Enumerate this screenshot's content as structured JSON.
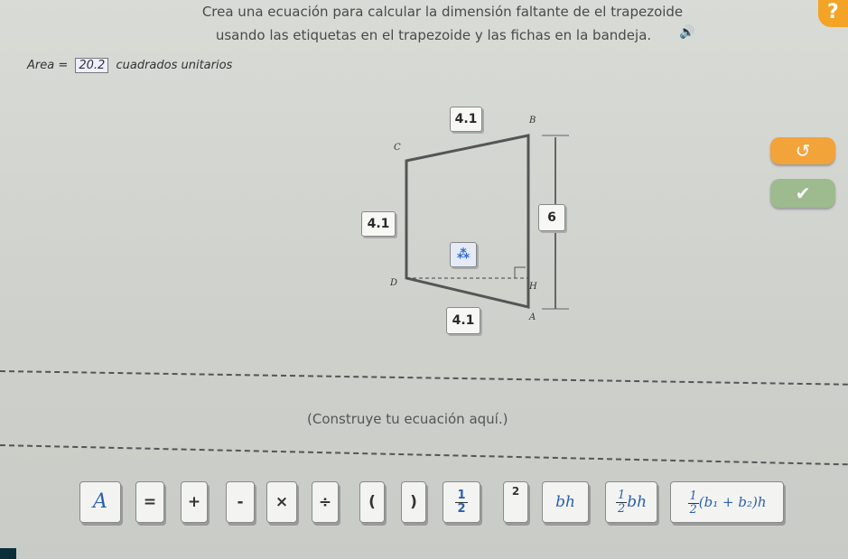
{
  "instructions": {
    "line1": "Crea una ecuación para calcular la dimensión faltante de el trapezoide",
    "line2": "usando las etiquetas en el trapezoide y las fichas en la bandeja."
  },
  "area": {
    "label": "Area =",
    "value": "20.2",
    "unit": "cuadrados unitarios"
  },
  "figure": {
    "top_tile": "4.1",
    "left_tile": "4.1",
    "bottom_tile": "4.1",
    "height_tile": "6",
    "vertices": {
      "b": "B",
      "c": "C",
      "d": "D",
      "a": "A",
      "h": "H"
    }
  },
  "prompt": "(Construye tu ecuación aquí.)",
  "tray": [
    {
      "id": "A",
      "label": "A"
    },
    {
      "id": "eq",
      "label": "="
    },
    {
      "id": "plus",
      "label": "+"
    },
    {
      "id": "minus",
      "label": "-"
    },
    {
      "id": "times",
      "label": "×"
    },
    {
      "id": "div",
      "label": "÷"
    },
    {
      "id": "lparen",
      "label": "("
    },
    {
      "id": "rparen",
      "label": ")"
    },
    {
      "id": "half_n",
      "label": "1"
    },
    {
      "id": "half_d",
      "label": "2"
    },
    {
      "id": "sq",
      "label": "2"
    },
    {
      "id": "bh",
      "label": "bh"
    },
    {
      "id": "halfbh_n",
      "label": "1"
    },
    {
      "id": "halfbh_d",
      "label": "2"
    },
    {
      "id": "halfbh_t",
      "label": "bh"
    },
    {
      "id": "trap_n",
      "label": "1"
    },
    {
      "id": "trap_d",
      "label": "2"
    },
    {
      "id": "trap_t",
      "label": "(b₁ + b₂)h"
    }
  ],
  "colors": {
    "hint": "#f3a326",
    "reset": "#f2a33a",
    "check": "#9dbb8f",
    "text_blue": "#2b5fb0"
  },
  "icons": {
    "hint": "lightbulb-icon",
    "speaker": "speaker-icon",
    "reset": "undo-icon",
    "check": "check-icon"
  }
}
